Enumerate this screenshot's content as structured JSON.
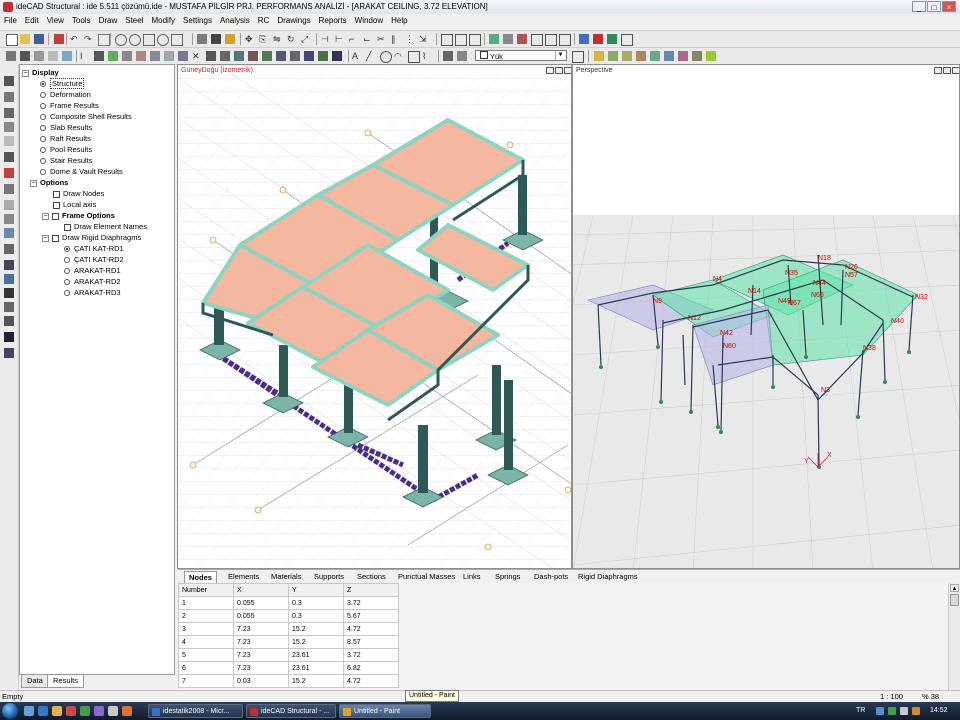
{
  "window": {
    "title": "ideCAD Structural : ide 5.511 çözümü.ide - MUSTAFA PİLGİR PRJ. PERFORMANS ANALİZİ - [ARAKAT CEILING,  3.72 ELEVATION]",
    "min": "_",
    "max": "□",
    "close": "×"
  },
  "menu": [
    "File",
    "Edit",
    "View",
    "Tools",
    "Draw",
    "Steel",
    "Modify",
    "Settings",
    "Analysis",
    "RC",
    "Drawings",
    "Reports",
    "Window",
    "Help"
  ],
  "toolbar": {
    "load_dropdown": "Yük"
  },
  "tree": {
    "display": "Display",
    "items": [
      {
        "label": "Structure",
        "selected": true
      },
      {
        "label": "Deformation"
      },
      {
        "label": "Frame Results"
      },
      {
        "label": "Composite Shell Results"
      },
      {
        "label": "Slab Results"
      },
      {
        "label": "Raft Results"
      },
      {
        "label": "Pool Results"
      },
      {
        "label": "Stair Results"
      },
      {
        "label": "Dome & Vault Results"
      }
    ],
    "options": "Options",
    "opts": [
      {
        "label": "Draw Nodes"
      },
      {
        "label": "Local axis"
      }
    ],
    "frame_options": "Frame Options",
    "draw_element_names": "Draw Element Names",
    "rigid": "Draw Rigid Diaphragms",
    "diaphragms": [
      {
        "label": "ÇATI KAT-RD1",
        "selected": true
      },
      {
        "label": "ÇATI KAT-RD2"
      },
      {
        "label": "ARAKAT-RD1"
      },
      {
        "label": "ARAKAT-RD2"
      },
      {
        "label": "ARAKAT-RD3"
      }
    ]
  },
  "left_tabs": [
    "Data",
    "Results"
  ],
  "viewport_left": {
    "label": "GüneyDoğu (izometrik)"
  },
  "viewport_right": {
    "label": "Perspective"
  },
  "nodes_labels": [
    "N18",
    "N26",
    "N57",
    "N4",
    "N35",
    "N44",
    "N32",
    "N9",
    "N14",
    "N49",
    "N12",
    "N67",
    "N66",
    "N42",
    "N40",
    "N60",
    "N38",
    "N3"
  ],
  "axis": {
    "y": "Y",
    "x": "X"
  },
  "bottom_tabs": [
    "Nodes",
    "Elements",
    "Materials",
    "Supports",
    "Sections",
    "Punctual Masses",
    "Links",
    "Springs",
    "Dash-pots",
    "Rigid Diaphragms"
  ],
  "table": {
    "headers": [
      "Number",
      "X",
      "Y",
      "Z"
    ],
    "rows": [
      [
        "1",
        "0.055",
        "0.3",
        "3.72"
      ],
      [
        "2",
        "0.055",
        "0.3",
        "5.67"
      ],
      [
        "3",
        "7.23",
        "15.2",
        "4.72"
      ],
      [
        "4",
        "7.23",
        "15.2",
        "8.57"
      ],
      [
        "5",
        "7.23",
        "23.61",
        "3.72"
      ],
      [
        "6",
        "7.23",
        "23.61",
        "6.82"
      ],
      [
        "7",
        "0.03",
        "15.2",
        "4.72"
      ]
    ]
  },
  "status": {
    "left": "Empty",
    "tooltip": "Untitled - Paint",
    "scale": "1 : 100",
    "zoom": "% 38"
  },
  "taskbar": {
    "tasks": [
      {
        "label": "idestatik2008 - Micr...",
        "color": "#3a6fc4"
      },
      {
        "label": "ideCAD Structural - ...",
        "color": "#c03030"
      },
      {
        "label": "Untitled - Paint",
        "color": "#e0a020",
        "active": true
      }
    ],
    "lang": "TR",
    "clock": "14:52"
  },
  "colors": {
    "slab": "#f4b8a0",
    "beam": "#8fd3c3",
    "column": "#2e5a56",
    "foundation": "#7ab5a8",
    "purple": "#4b2c8a",
    "green_slab": "#5fe3a8",
    "node_label": "#cc0000"
  }
}
